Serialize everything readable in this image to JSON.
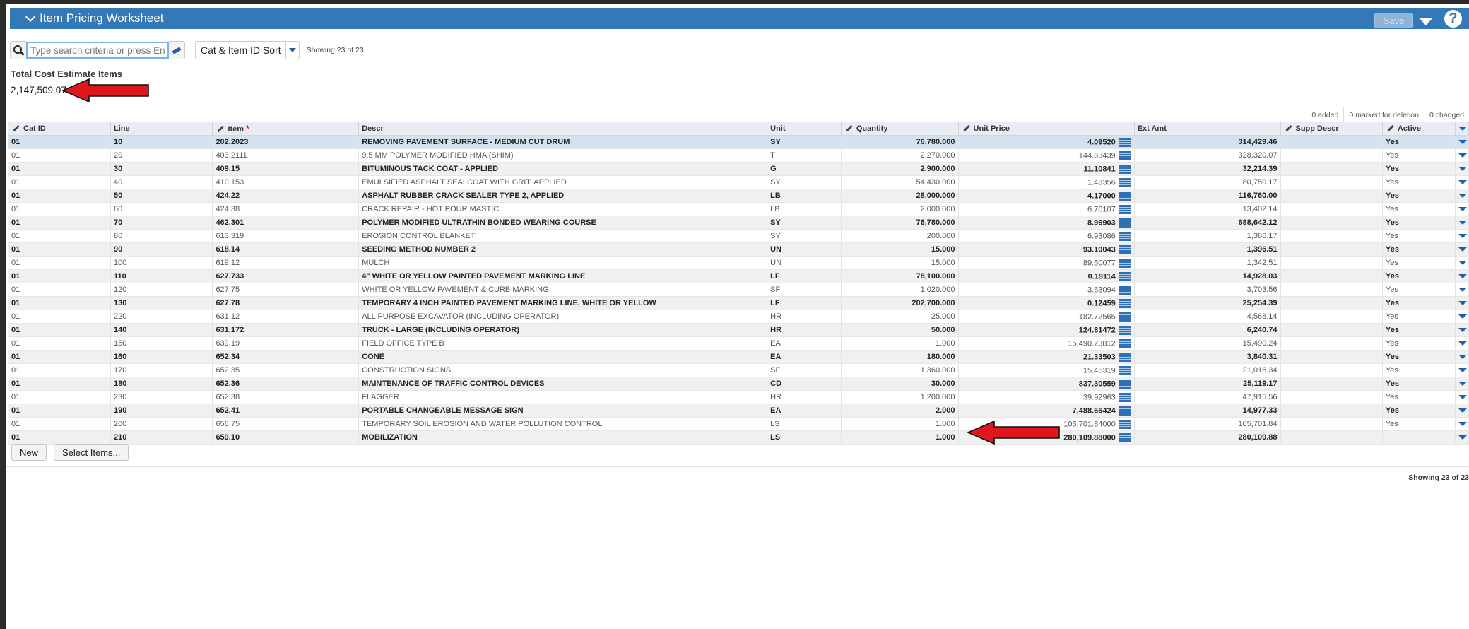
{
  "header": {
    "title": "Item Pricing Worksheet",
    "save_label": "Save",
    "help_label": "?"
  },
  "toolbar": {
    "search_placeholder": "Type search criteria or press Enter",
    "sort_label": "Cat & Item ID Sort",
    "showing_text": "Showing 23 of 23"
  },
  "summary": {
    "title": "Total Cost Estimate Items",
    "value": "2,147,509.07"
  },
  "changes": {
    "added": "0 added",
    "deleted": "0 marked for deletion",
    "changed": "0 changed"
  },
  "columns": {
    "cat_id": "Cat ID",
    "line": "Line",
    "item": "Item",
    "required": "*",
    "descr": "Descr",
    "unit": "Unit",
    "quantity": "Quantity",
    "unit_price": "Unit Price",
    "ext_amt": "Ext Amt",
    "supp_descr": "Supp Descr",
    "active": "Active"
  },
  "rows": [
    {
      "cat": "01",
      "line": "10",
      "item": "202.2023",
      "descr": "REMOVING PAVEMENT SURFACE - MEDIUM CUT DRUM",
      "unit": "SY",
      "qty": "76,780.000",
      "price": "4.09520",
      "ext": "314,429.46",
      "supp": "",
      "active": "Yes"
    },
    {
      "cat": "01",
      "line": "20",
      "item": "403.2111",
      "descr": "9.5 MM POLYMER MODIFIED HMA (SHIM)",
      "unit": "T",
      "qty": "2,270.000",
      "price": "144.63439",
      "ext": "328,320.07",
      "supp": "",
      "active": "Yes"
    },
    {
      "cat": "01",
      "line": "30",
      "item": "409.15",
      "descr": "BITUMINOUS TACK COAT - APPLIED",
      "unit": "G",
      "qty": "2,900.000",
      "price": "11.10841",
      "ext": "32,214.39",
      "supp": "",
      "active": "Yes"
    },
    {
      "cat": "01",
      "line": "40",
      "item": "410.153",
      "descr": "EMULSIFIED ASPHALT SEALCOAT WITH GRIT, APPLIED",
      "unit": "SY",
      "qty": "54,430.000",
      "price": "1.48356",
      "ext": "80,750.17",
      "supp": "",
      "active": "Yes"
    },
    {
      "cat": "01",
      "line": "50",
      "item": "424.22",
      "descr": "ASPHALT RUBBER CRACK SEALER TYPE 2, APPLIED",
      "unit": "LB",
      "qty": "28,000.000",
      "price": "4.17000",
      "ext": "116,760.00",
      "supp": "",
      "active": "Yes"
    },
    {
      "cat": "01",
      "line": "60",
      "item": "424.38",
      "descr": "CRACK REPAIR - HOT POUR MASTIC",
      "unit": "LB",
      "qty": "2,000.000",
      "price": "6.70107",
      "ext": "13,402.14",
      "supp": "",
      "active": "Yes"
    },
    {
      "cat": "01",
      "line": "70",
      "item": "462.301",
      "descr": "POLYMER MODIFIED ULTRATHIN BONDED WEARING COURSE",
      "unit": "SY",
      "qty": "76,780.000",
      "price": "8.96903",
      "ext": "688,642.12",
      "supp": "",
      "active": "Yes"
    },
    {
      "cat": "01",
      "line": "80",
      "item": "613.319",
      "descr": "EROSION CONTROL BLANKET",
      "unit": "SY",
      "qty": "200.000",
      "price": "6.93086",
      "ext": "1,386.17",
      "supp": "",
      "active": "Yes"
    },
    {
      "cat": "01",
      "line": "90",
      "item": "618.14",
      "descr": "SEEDING METHOD NUMBER 2",
      "unit": "UN",
      "qty": "15.000",
      "price": "93.10043",
      "ext": "1,396.51",
      "supp": "",
      "active": "Yes"
    },
    {
      "cat": "01",
      "line": "100",
      "item": "619.12",
      "descr": "MULCH",
      "unit": "UN",
      "qty": "15.000",
      "price": "89.50077",
      "ext": "1,342.51",
      "supp": "",
      "active": "Yes"
    },
    {
      "cat": "01",
      "line": "110",
      "item": "627.733",
      "descr": "4\" WHITE OR YELLOW PAINTED PAVEMENT MARKING LINE",
      "unit": "LF",
      "qty": "78,100.000",
      "price": "0.19114",
      "ext": "14,928.03",
      "supp": "",
      "active": "Yes"
    },
    {
      "cat": "01",
      "line": "120",
      "item": "627.75",
      "descr": "WHITE OR YELLOW PAVEMENT & CURB MARKING",
      "unit": "SF",
      "qty": "1,020.000",
      "price": "3.63094",
      "ext": "3,703.56",
      "supp": "",
      "active": "Yes"
    },
    {
      "cat": "01",
      "line": "130",
      "item": "627.78",
      "descr": "TEMPORARY 4 INCH PAINTED PAVEMENT MARKING LINE, WHITE OR YELLOW",
      "unit": "LF",
      "qty": "202,700.000",
      "price": "0.12459",
      "ext": "25,254.39",
      "supp": "",
      "active": "Yes"
    },
    {
      "cat": "01",
      "line": "220",
      "item": "631.12",
      "descr": "ALL PURPOSE EXCAVATOR (INCLUDING OPERATOR)",
      "unit": "HR",
      "qty": "25.000",
      "price": "182.72565",
      "ext": "4,568.14",
      "supp": "",
      "active": "Yes"
    },
    {
      "cat": "01",
      "line": "140",
      "item": "631.172",
      "descr": "TRUCK - LARGE (INCLUDING OPERATOR)",
      "unit": "HR",
      "qty": "50.000",
      "price": "124.81472",
      "ext": "6,240.74",
      "supp": "",
      "active": "Yes"
    },
    {
      "cat": "01",
      "line": "150",
      "item": "639.19",
      "descr": "FIELD OFFICE TYPE B",
      "unit": "EA",
      "qty": "1.000",
      "price": "15,490.23812",
      "ext": "15,490.24",
      "supp": "",
      "active": "Yes"
    },
    {
      "cat": "01",
      "line": "160",
      "item": "652.34",
      "descr": "CONE",
      "unit": "EA",
      "qty": "180.000",
      "price": "21.33503",
      "ext": "3,840.31",
      "supp": "",
      "active": "Yes"
    },
    {
      "cat": "01",
      "line": "170",
      "item": "652.35",
      "descr": "CONSTRUCTION SIGNS",
      "unit": "SF",
      "qty": "1,360.000",
      "price": "15.45319",
      "ext": "21,016.34",
      "supp": "",
      "active": "Yes"
    },
    {
      "cat": "01",
      "line": "180",
      "item": "652.36",
      "descr": "MAINTENANCE OF TRAFFIC CONTROL DEVICES",
      "unit": "CD",
      "qty": "30.000",
      "price": "837.30559",
      "ext": "25,119.17",
      "supp": "",
      "active": "Yes"
    },
    {
      "cat": "01",
      "line": "230",
      "item": "652.38",
      "descr": "FLAGGER",
      "unit": "HR",
      "qty": "1,200.000",
      "price": "39.92963",
      "ext": "47,915.56",
      "supp": "",
      "active": "Yes"
    },
    {
      "cat": "01",
      "line": "190",
      "item": "652.41",
      "descr": "PORTABLE CHANGEABLE MESSAGE SIGN",
      "unit": "EA",
      "qty": "2.000",
      "price": "7,488.66424",
      "ext": "14,977.33",
      "supp": "",
      "active": "Yes"
    },
    {
      "cat": "01",
      "line": "200",
      "item": "656.75",
      "descr": "TEMPORARY SOIL EROSION AND WATER POLLUTION CONTROL",
      "unit": "LS",
      "qty": "1.000",
      "price": "105,701.84000",
      "ext": "105,701.84",
      "supp": "",
      "active": "Yes"
    },
    {
      "cat": "01",
      "line": "210",
      "item": "659.10",
      "descr": "MOBILIZATION",
      "unit": "LS",
      "qty": "1.000",
      "price": "280,109.88000",
      "ext": "280,109.88",
      "supp": "",
      "active": ""
    }
  ],
  "footer": {
    "new_label": "New",
    "select_label": "Select Items...",
    "showing_text": "Showing 23 of 23"
  },
  "icons": {
    "collapse": "chevron-down-icon",
    "search": "search-icon",
    "clear": "eraser-icon",
    "edit": "pencil-icon",
    "calculator": "calculator-icon",
    "annotation": "red-arrow-icon"
  },
  "colors": {
    "header": "#3379b7",
    "arrow": "#e0161d",
    "selected_row": "#d4e2f0"
  }
}
